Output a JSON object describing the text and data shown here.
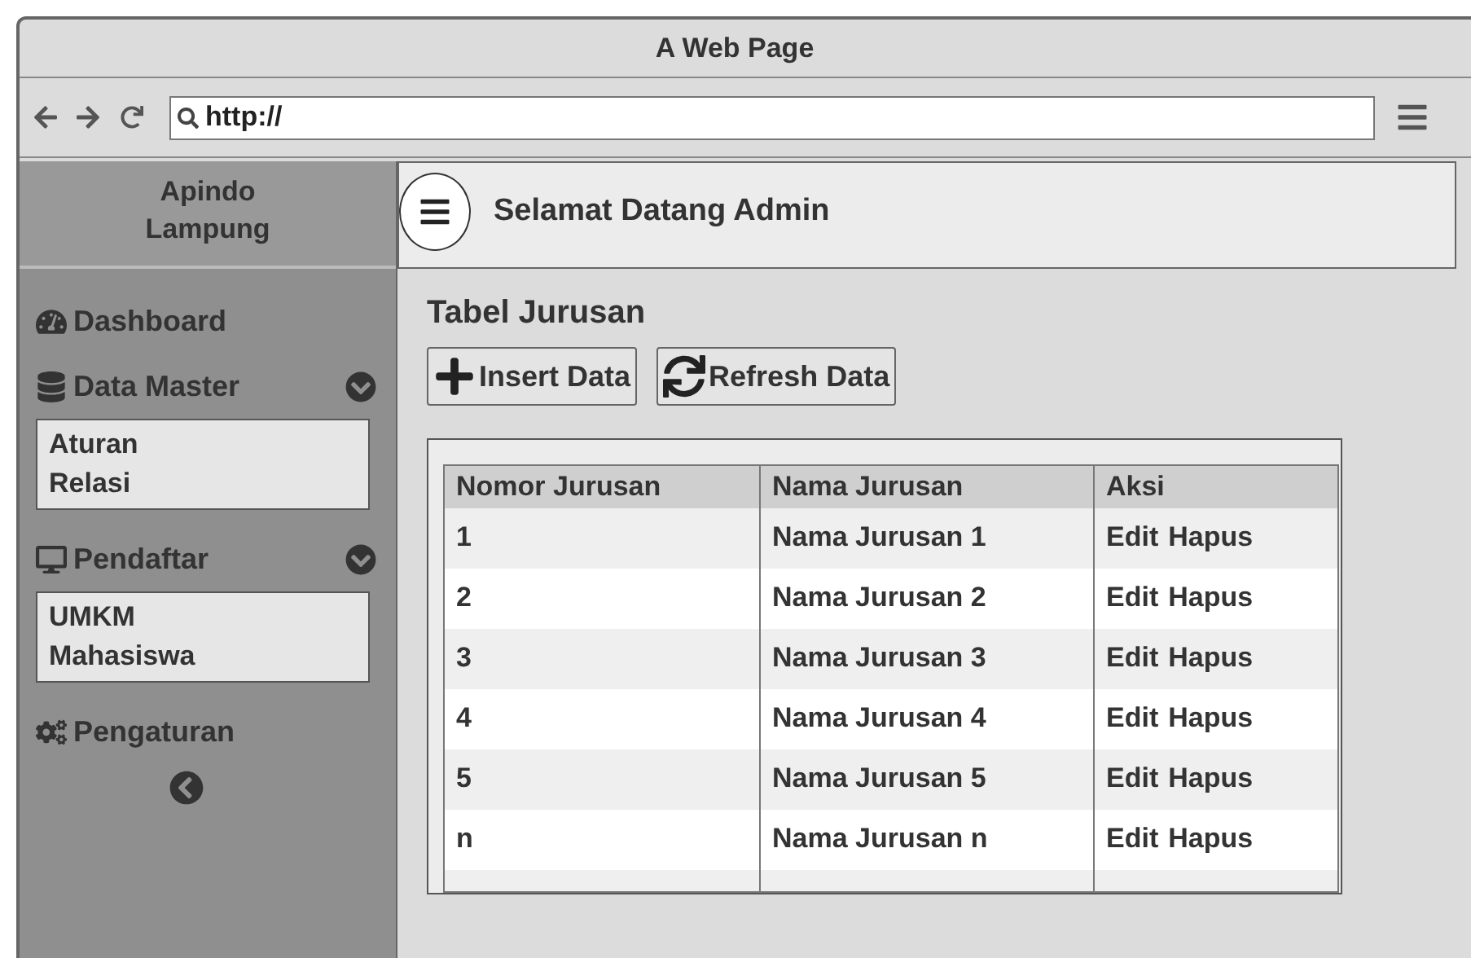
{
  "window": {
    "title": "A Web Page"
  },
  "address_bar": {
    "value": "http://"
  },
  "sidebar": {
    "brand": "Apindo\nLampung",
    "items": [
      {
        "label": "Dashboard",
        "kind": "link"
      },
      {
        "label": "Data Master",
        "kind": "group",
        "expanded": true,
        "children": [
          "Aturan",
          "Relasi"
        ]
      },
      {
        "label": "Pendaftar",
        "kind": "group",
        "expanded": true,
        "children": [
          "UMKM",
          "Mahasiswa"
        ]
      },
      {
        "label": "Pengaturan",
        "kind": "link"
      }
    ]
  },
  "header": {
    "title": "Selamat Datang Admin"
  },
  "content": {
    "title": "Tabel Jurusan",
    "buttons": [
      "Insert Data",
      "Refresh Data"
    ],
    "table": {
      "columns": [
        "Nomor Jurusan",
        "Nama Jurusan",
        "Aksi"
      ],
      "rows": [
        {
          "number": "1",
          "name": "Nama Jurusan 1",
          "actions": [
            "Edit",
            "Hapus"
          ]
        },
        {
          "number": "2",
          "name": "Nama Jurusan 2",
          "actions": [
            "Edit",
            "Hapus"
          ]
        },
        {
          "number": "3",
          "name": "Nama Jurusan 3",
          "actions": [
            "Edit",
            "Hapus"
          ]
        },
        {
          "number": "4",
          "name": "Nama Jurusan 4",
          "actions": [
            "Edit",
            "Hapus"
          ]
        },
        {
          "number": "5",
          "name": "Nama Jurusan 5",
          "actions": [
            "Edit",
            "Hapus"
          ]
        },
        {
          "number": "n",
          "name": "Nama Jurusan n",
          "actions": [
            "Edit",
            "Hapus"
          ]
        }
      ]
    }
  }
}
